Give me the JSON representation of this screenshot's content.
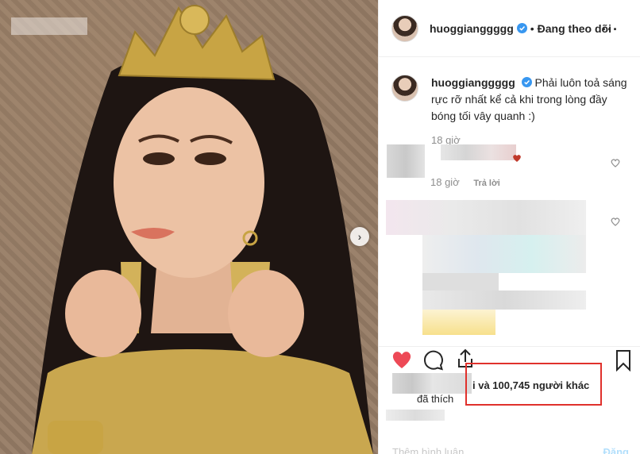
{
  "header": {
    "username": "huoggianggggg",
    "separator": "•",
    "follow_state": "Đang theo dõi",
    "more_icon": "more-horizontal-icon"
  },
  "caption": {
    "username": "huoggianggggg",
    "text": "Phải luôn toả sáng rực rỡ nhất kể cả khi trong lòng đầy bóng tối vây quanh :)",
    "time": "18 giờ"
  },
  "comments": [
    {
      "time": "18 giờ",
      "reply_label": "Trả lời"
    }
  ],
  "actions": {
    "like_icon": "heart-filled-icon",
    "comment_icon": "comment-icon",
    "share_icon": "share-icon",
    "save_icon": "bookmark-icon"
  },
  "likes": {
    "text": "i và 100,745 người khác",
    "liked_suffix": "đã thích"
  },
  "add_comment": {
    "placeholder": "Thêm bình luận...",
    "post_label": "Đăng"
  },
  "colors": {
    "like_red": "#ed4956",
    "verified_blue": "#3897f0",
    "highlight_box": "#e0312c"
  }
}
